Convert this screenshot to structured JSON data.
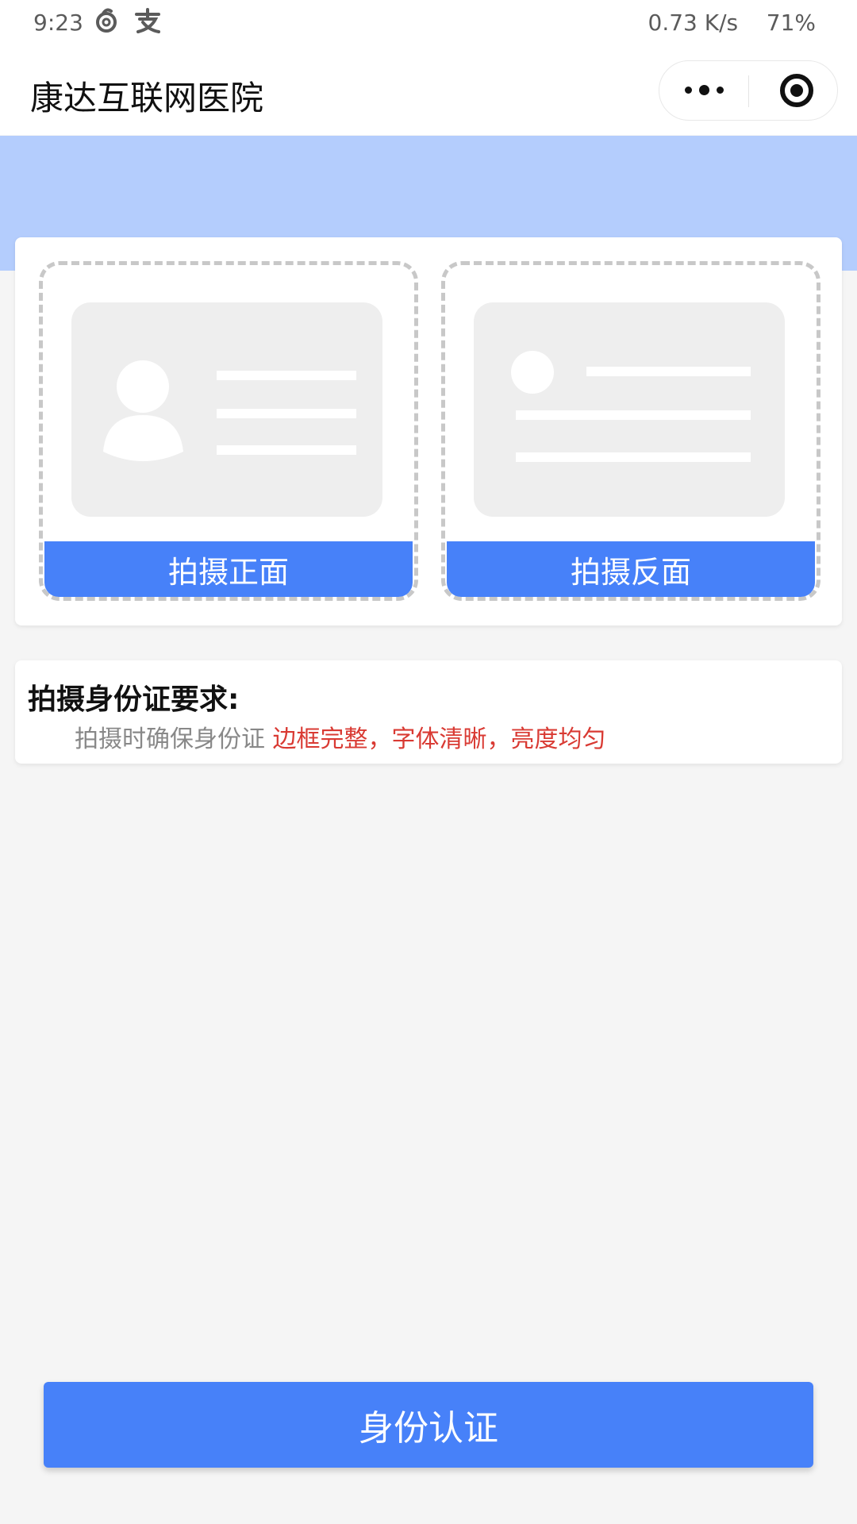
{
  "status_bar": {
    "time": "9:23",
    "network_speed": "0.73 K/s",
    "battery": "71%",
    "icons": [
      "netease-music-icon",
      "alipay-icon"
    ]
  },
  "nav": {
    "title": "康达互联网医院"
  },
  "upload": {
    "front_label": "拍摄正面",
    "back_label": "拍摄反面"
  },
  "requirements": {
    "title": "拍摄身份证要求:",
    "text": "拍摄时确保身份证",
    "highlight": "边框完整，字体清晰，亮度均匀"
  },
  "submit_label": "身份认证",
  "colors": {
    "primary": "#4781f9",
    "header_band": "#b4cdfd",
    "highlight": "#d93a33",
    "background": "#f5f5f5"
  }
}
